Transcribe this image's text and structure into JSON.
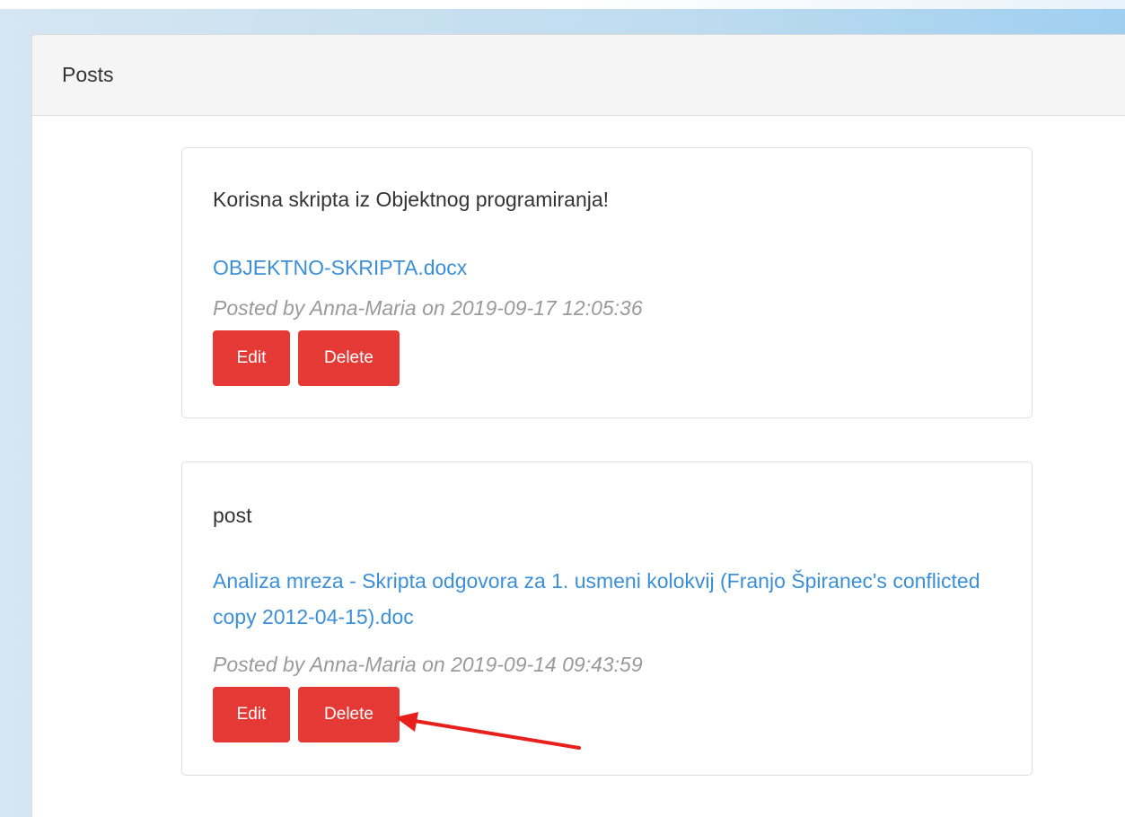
{
  "panel": {
    "heading": "Posts"
  },
  "posts": [
    {
      "body": "Korisna skripta iz Objektnog programiranja!",
      "attachment": "OBJEKTNO-SKRIPTA.docx",
      "meta": "Posted by Anna-Maria on 2019-09-17 12:05:36",
      "edit_label": "Edit",
      "delete_label": "Delete"
    },
    {
      "body": "post",
      "attachment": "Analiza mreza - Skripta odgovora za 1. usmeni kolokvij (Franjo Špiranec's conflicted copy 2012-04-15).doc",
      "meta": "Posted by Anna-Maria on 2019-09-14 09:43:59",
      "edit_label": "Edit",
      "delete_label": "Delete"
    }
  ],
  "annotation": {
    "arrow_color": "#e8201c"
  },
  "colors": {
    "button": "#e53935",
    "link": "#3a8fd8",
    "meta": "#9a9a9a"
  }
}
